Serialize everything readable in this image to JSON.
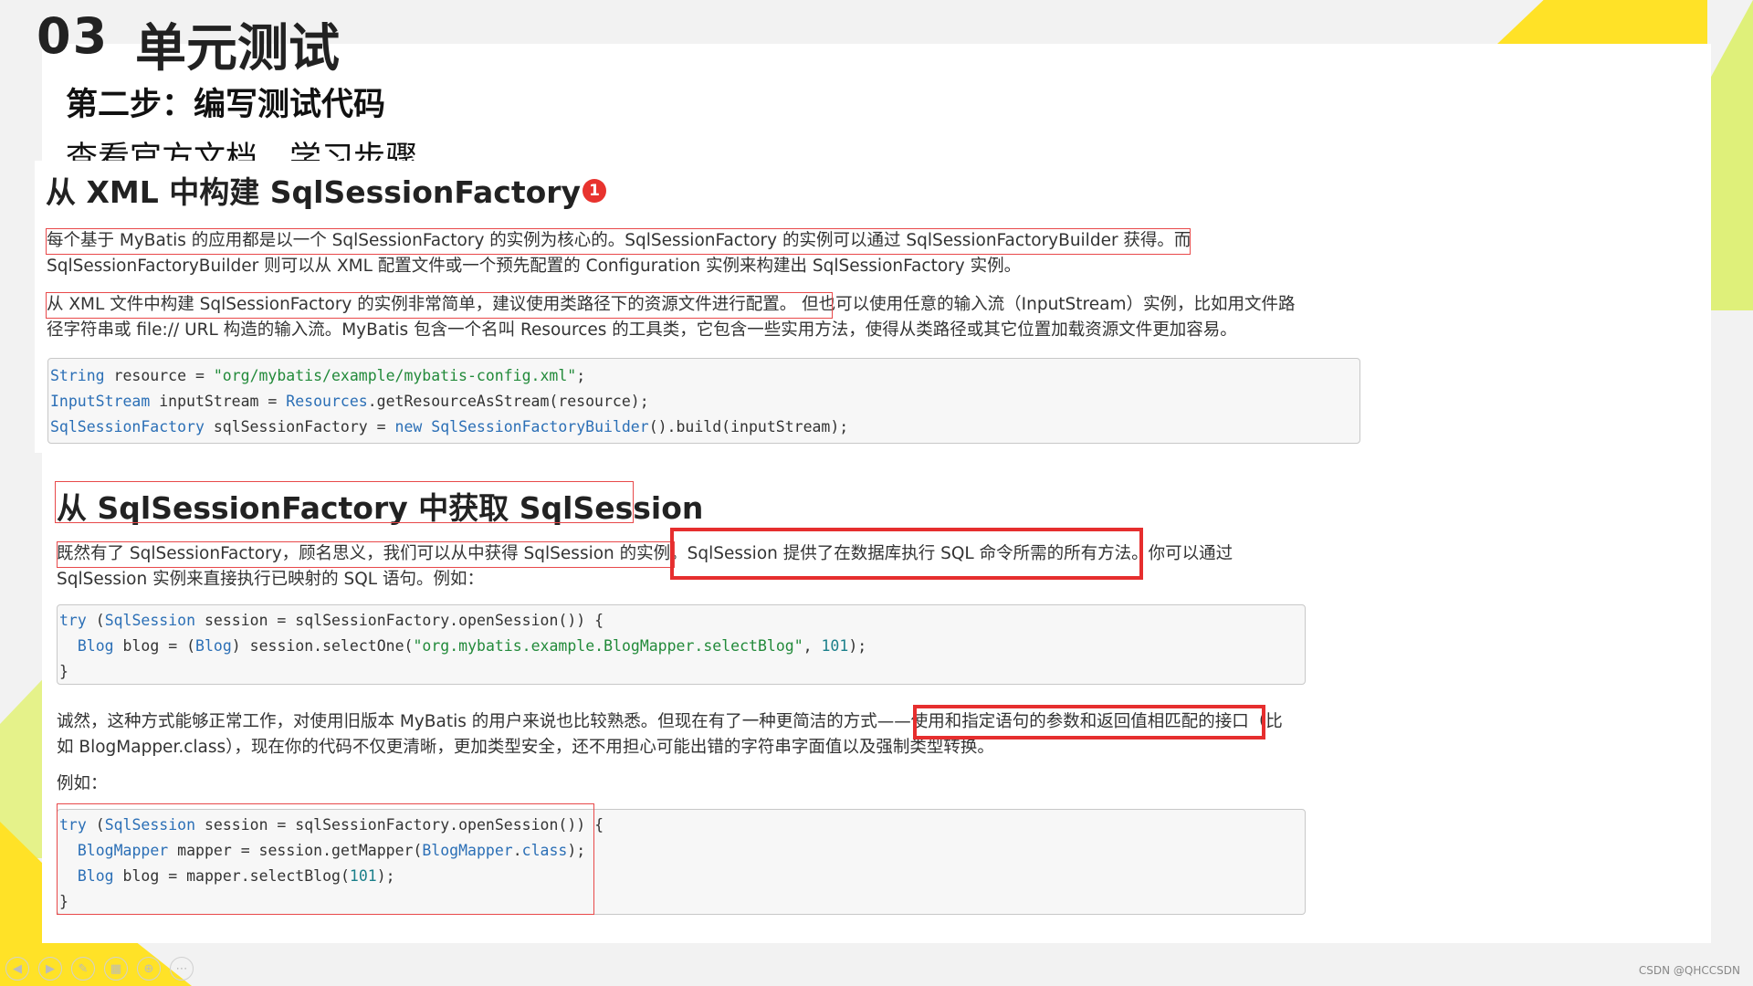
{
  "slide": {
    "number": "03",
    "title": "单元测试",
    "step_heading": "第二步：编写测试代码",
    "step_sub": "查看官方文档，学习步骤"
  },
  "section1": {
    "heading": "从 XML 中构建 SqlSessionFactory",
    "badge": "1",
    "para1_line1": "每个基于 MyBatis 的应用都是以一个 SqlSessionFactory 的实例为核心的。SqlSessionFactory 的实例可以通过 SqlSessionFactoryBuilder 获得。而",
    "para1_line2": "SqlSessionFactoryBuilder 则可以从 XML 配置文件或一个预先配置的 Configuration 实例来构建出 SqlSessionFactory 实例。",
    "para2_line1": "从 XML 文件中构建 SqlSessionFactory 的实例非常简单，建议使用类路径下的资源文件进行配置。 但也可以使用任意的输入流（InputStream）实例，比如用文件路",
    "para2_line2": "径字符串或 file:// URL 构造的输入流。MyBatis 包含一个名叫 Resources 的工具类，它包含一些实用方法，使得从类路径或其它位置加载资源文件更加容易。",
    "code": [
      "String resource = \"org/mybatis/example/mybatis-config.xml\";",
      "InputStream inputStream = Resources.getResourceAsStream(resource);",
      "SqlSessionFactory sqlSessionFactory = new SqlSessionFactoryBuilder().build(inputStream);"
    ]
  },
  "section2": {
    "heading": "从 SqlSessionFactory 中获取 SqlSession",
    "para1_line1": "既然有了 SqlSessionFactory，顾名思义，我们可以从中获得 SqlSession 的实例。SqlSession 提供了在数据库执行 SQL 命令所需的所有方法。你可以通过",
    "para1_line2": "SqlSession 实例来直接执行已映射的 SQL 语句。例如：",
    "code1": [
      "try (SqlSession session = sqlSessionFactory.openSession()) {",
      "  Blog blog = (Blog) session.selectOne(\"org.mybatis.example.BlogMapper.selectBlog\", 101);",
      "}"
    ],
    "para2_line1": "诚然，这种方式能够正常工作，对使用旧版本 MyBatis 的用户来说也比较熟悉。但现在有了一种更简洁的方式——使用和指定语句的参数和返回值相匹配的接口（比",
    "para2_line2": "如 BlogMapper.class），现在你的代码不仅更清晰，更加类型安全，还不用担心可能出错的字符串字面值以及强制类型转换。",
    "para3": "例如：",
    "code2": [
      "try (SqlSession session = sqlSessionFactory.openSession()) {",
      "  BlogMapper mapper = session.getMapper(BlogMapper.class);",
      "  Blog blog = mapper.selectBlog(101);",
      "}"
    ]
  },
  "toolbar": {
    "buttons": [
      "prev-icon",
      "next-icon",
      "pen-icon",
      "slides-icon",
      "zoom-icon",
      "more-icon"
    ]
  },
  "colors": {
    "accent_yellow": "#ffe227",
    "accent_green": "#dff07a",
    "highlight_red": "#e62e2e",
    "keyword_blue": "#2b6fb6",
    "string_green": "#228a3a"
  },
  "watermark": "CSDN @QHCCSDN"
}
